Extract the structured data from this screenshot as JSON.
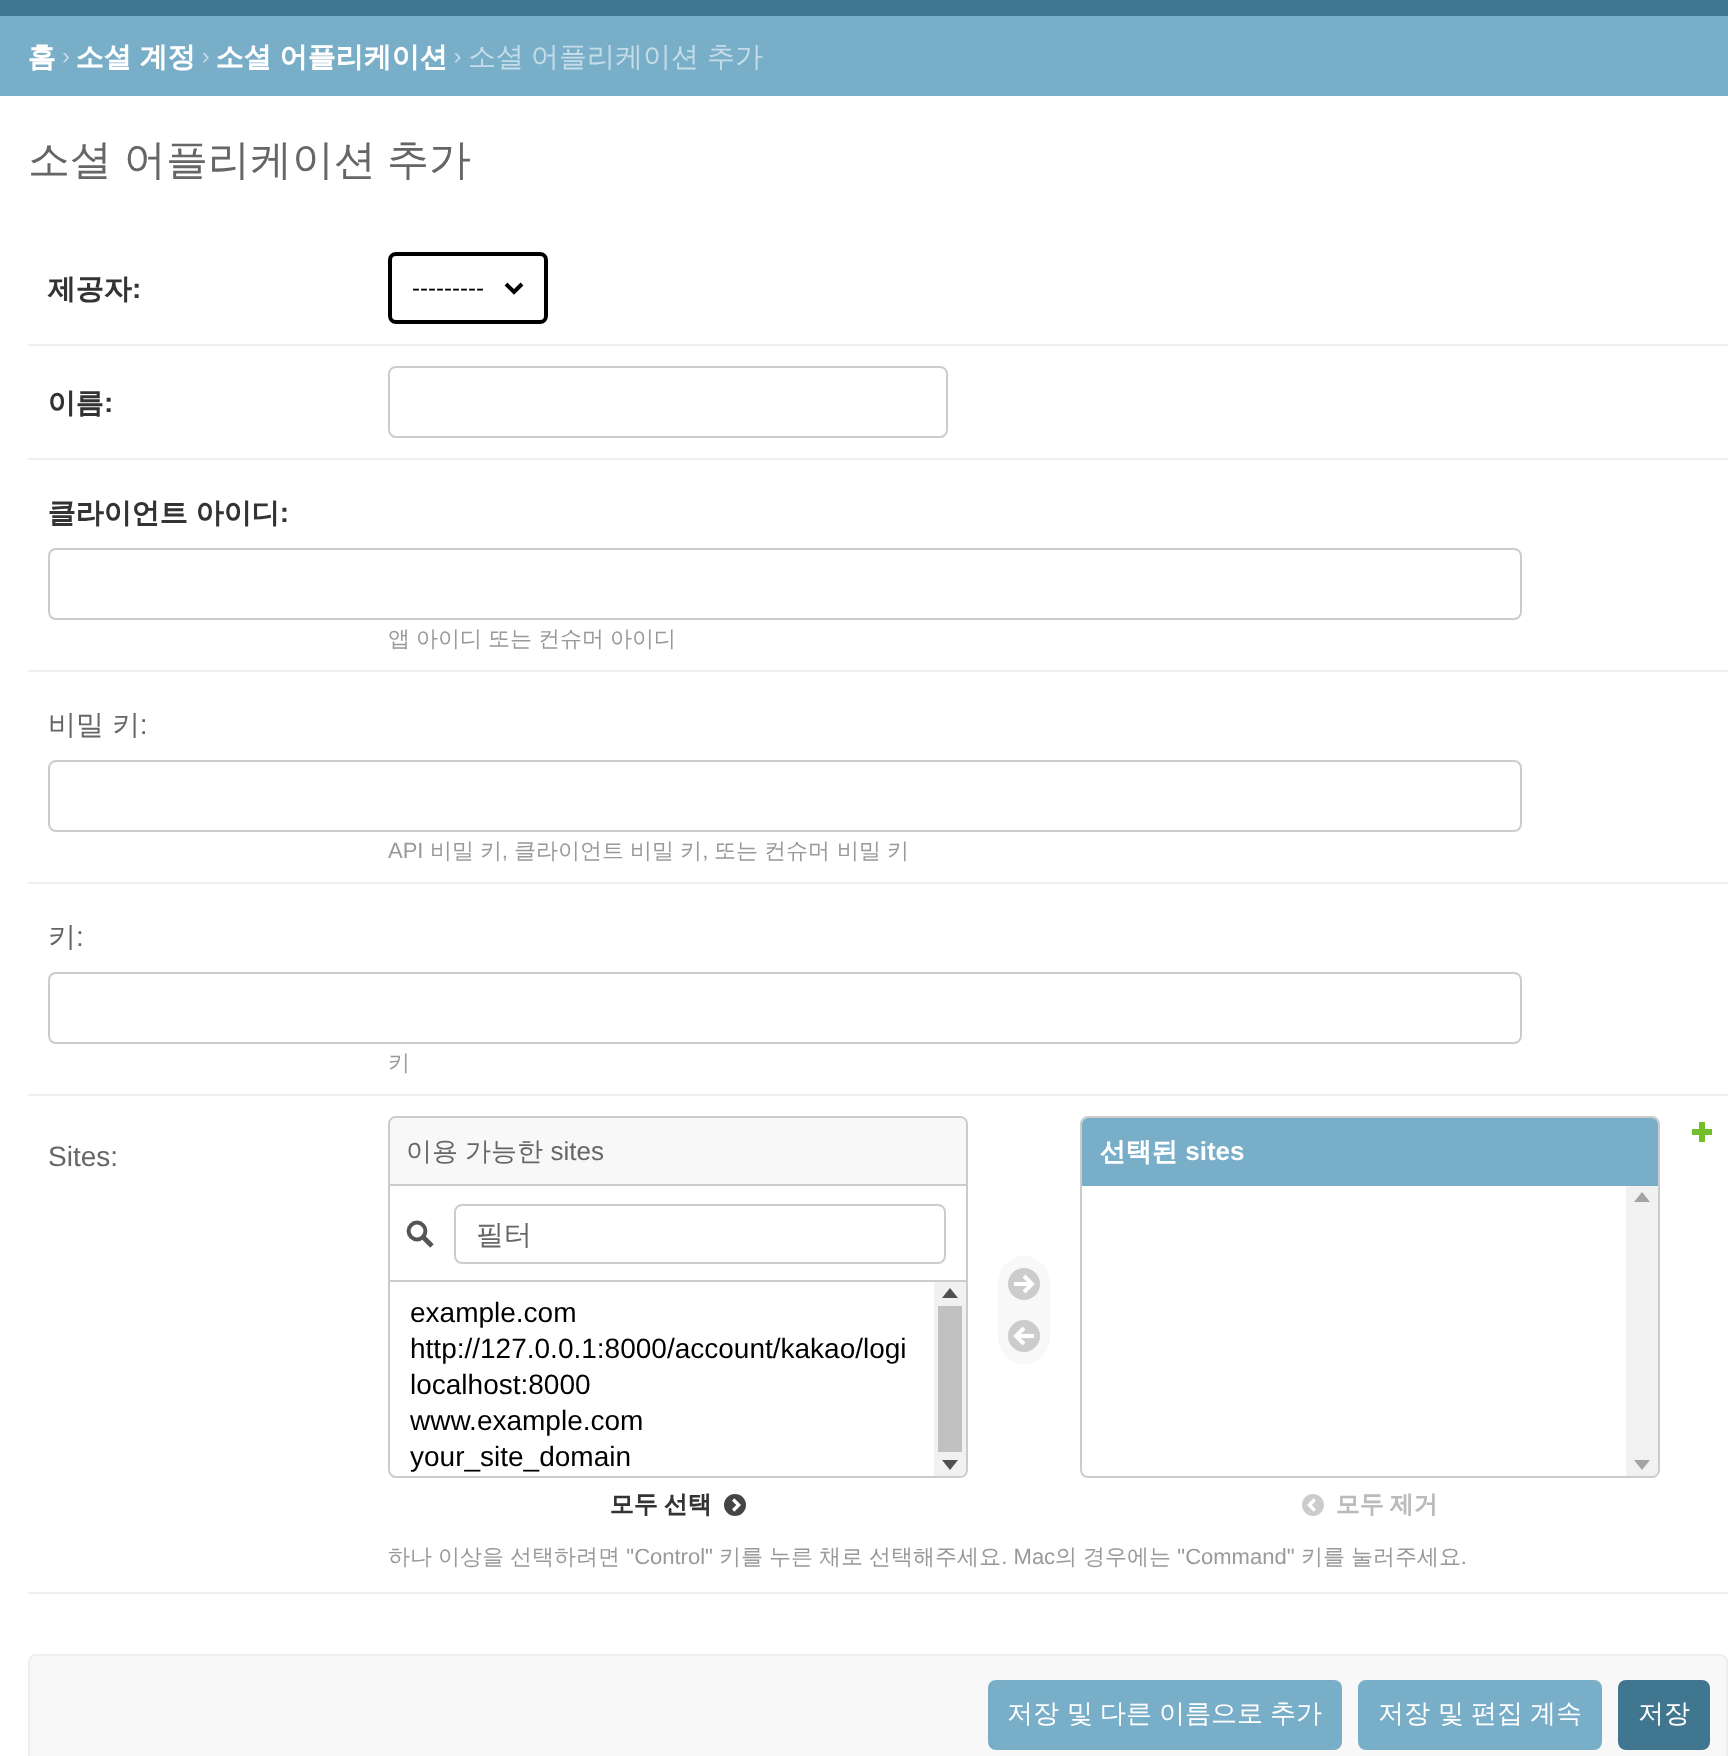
{
  "breadcrumbs": [
    {
      "label": "홈",
      "link": true
    },
    {
      "label": "소셜 계정",
      "link": true
    },
    {
      "label": "소셜 어플리케이션",
      "link": true
    },
    {
      "label": "소셜 어플리케이션 추가",
      "link": false
    }
  ],
  "breadcrumb_separator": "›",
  "title": "소셜 어플리케이션 추가",
  "fields": [
    {
      "kind": "select",
      "label": "제공자:",
      "required": true,
      "value": "---------"
    },
    {
      "kind": "short",
      "label": "이름:",
      "required": true
    },
    {
      "kind": "wide",
      "label": "클라이언트 아이디:",
      "required": true,
      "help": "앱 아이디 또는 컨슈머 아이디"
    },
    {
      "kind": "wide",
      "label": "비밀 키:",
      "required": false,
      "help": "API 비밀 키, 클라이언트 비밀 키, 또는 컨슈머 비밀 키"
    },
    {
      "kind": "wide",
      "label": "키:",
      "required": false,
      "help": "키"
    }
  ],
  "sites": {
    "label": "Sites:",
    "available_title": "이용 가능한 sites",
    "filter_placeholder": "필터",
    "options": [
      "example.com",
      "http://127.0.0.1:8000/account/kakao/logi",
      "localhost:8000",
      "www.example.com",
      "your_site_domain"
    ],
    "chosen_title": "선택된 sites",
    "arrows": [
      {
        "kind": "add",
        "disabled": true
      },
      {
        "kind": "remove",
        "disabled": true
      }
    ],
    "choose_all": {
      "label": "모두 선택",
      "disabled": false
    },
    "remove_all": {
      "label": "모두 제거",
      "disabled": true
    },
    "help": "하나 이상을 선택하려면 \"Control\" 키를 누른 채로 선택해주세요. Mac의 경우에는 \"Command\" 키를 눌러주세요."
  },
  "buttons": [
    {
      "label": "저장 및 다른 이름으로 추가",
      "primary": false
    },
    {
      "label": "저장 및 편집 계속",
      "primary": false
    },
    {
      "label": "저장",
      "primary": true
    }
  ]
}
